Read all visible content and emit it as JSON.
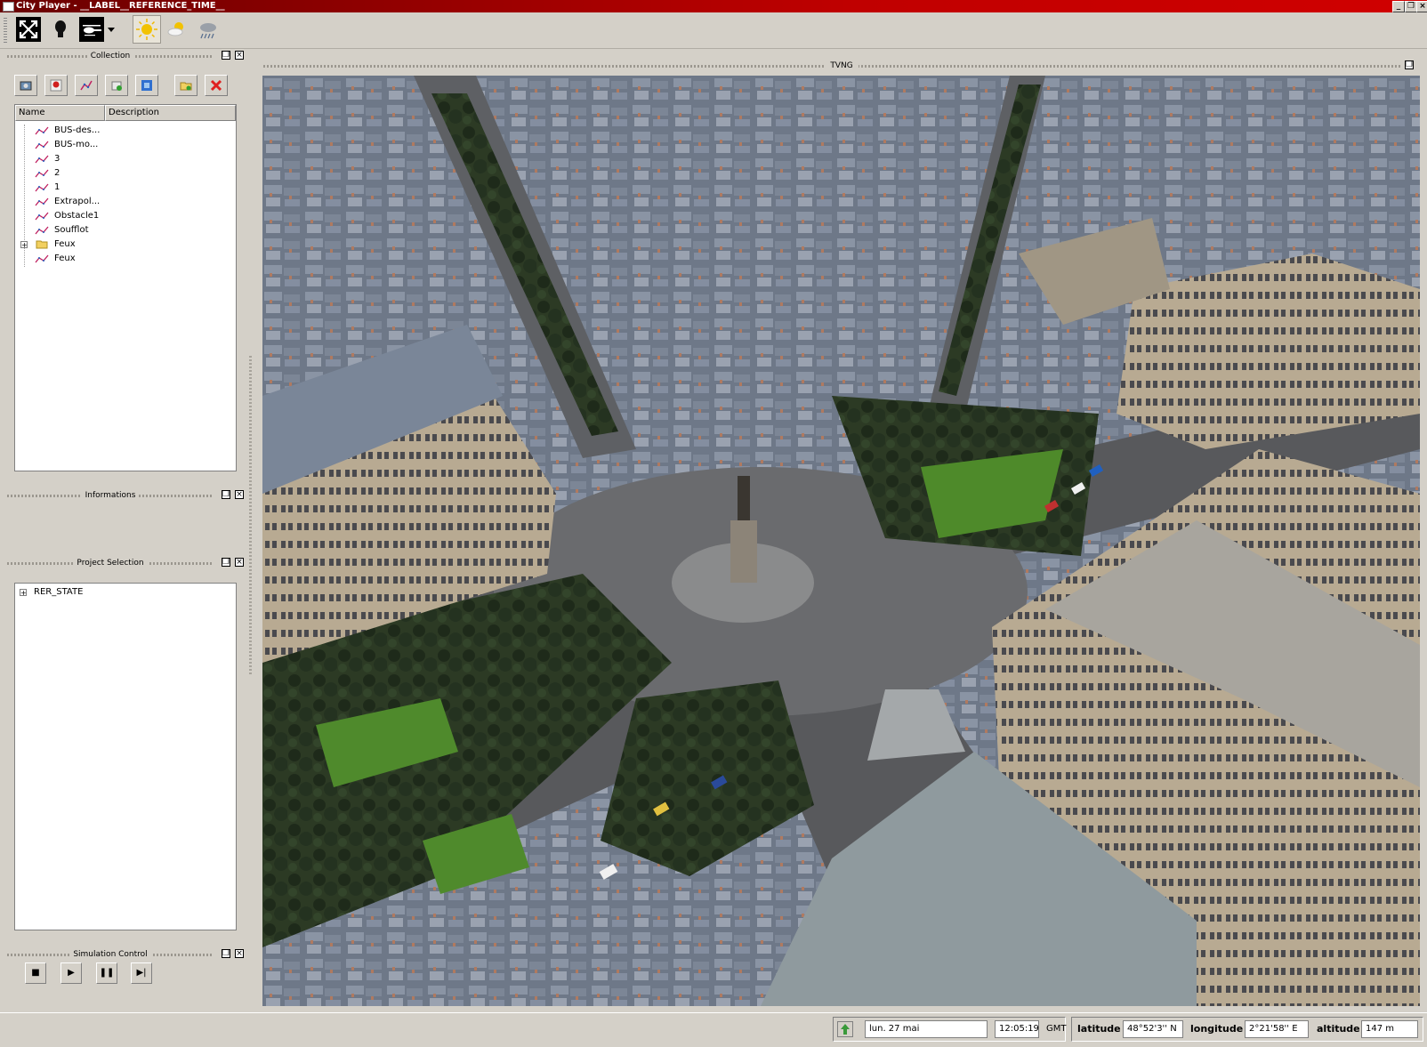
{
  "window": {
    "title": "City Player - __LABEL__REFERENCE_TIME__"
  },
  "toolbar": {
    "buttons": [
      {
        "name": "fullscreen-toggle",
        "icon": "expand-arrows-icon"
      },
      {
        "name": "light-bulb",
        "icon": "light-bulb-icon"
      },
      {
        "name": "helicopter-camera",
        "icon": "helicopter-icon"
      },
      {
        "name": "camera-dropdown",
        "icon": "triangle-down-icon"
      },
      {
        "name": "weather-sunny",
        "icon": "sun-icon",
        "selected": true
      },
      {
        "name": "weather-cloudy",
        "icon": "sun-cloud-icon"
      },
      {
        "name": "weather-rain",
        "icon": "rain-cloud-icon"
      }
    ]
  },
  "collection": {
    "title": "Collection",
    "columns": [
      "Name",
      "Description"
    ],
    "items": [
      {
        "label": "BUS-des...",
        "icon": "path-icon"
      },
      {
        "label": "BUS-mo...",
        "icon": "path-icon"
      },
      {
        "label": "3",
        "icon": "path-icon"
      },
      {
        "label": "2",
        "icon": "path-icon"
      },
      {
        "label": "1",
        "icon": "path-icon"
      },
      {
        "label": "Extrapol...",
        "icon": "path-icon"
      },
      {
        "label": "Obstacle1",
        "icon": "path-icon"
      },
      {
        "label": "Soufflot",
        "icon": "path-icon"
      },
      {
        "label": "Feux",
        "icon": "folder-icon",
        "expandable": true
      },
      {
        "label": "Feux",
        "icon": "path-icon"
      }
    ]
  },
  "informations": {
    "title": "Informations"
  },
  "project_selection": {
    "title": "Project Selection",
    "items": [
      {
        "label": "RER_STATE",
        "expandable": true
      }
    ]
  },
  "simulation_control": {
    "title": "Simulation Control",
    "buttons": [
      {
        "name": "stop",
        "icon": "stop-icon",
        "glyph": "■"
      },
      {
        "name": "play",
        "icon": "play-icon",
        "glyph": "▶"
      },
      {
        "name": "pause",
        "icon": "pause-icon",
        "glyph": "❚❚"
      },
      {
        "name": "step",
        "icon": "step-forward-icon",
        "glyph": "▶|"
      }
    ]
  },
  "view": {
    "title": "TVNG"
  },
  "status": {
    "date": "lun. 27 mai",
    "time": "12:05:19",
    "timezone": "GMT",
    "latitude_label": "latitude",
    "latitude": "48°52'3'' N",
    "longitude_label": "longitude",
    "longitude": "2°21'58'' E",
    "altitude_label": "altitude",
    "altitude": "147 m"
  },
  "colors": {
    "titlebar_start": "#6a0000",
    "titlebar_end": "#d00000",
    "chrome": "#d4d0c8",
    "close_red": "#e02020"
  }
}
